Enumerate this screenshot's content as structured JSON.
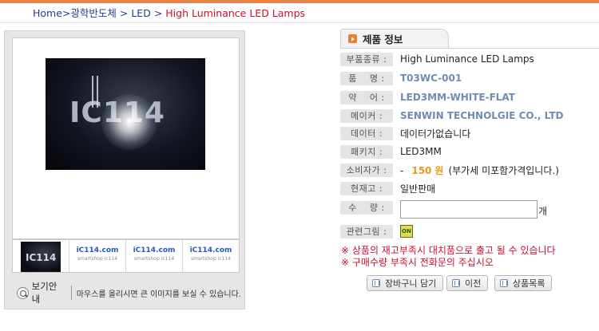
{
  "breadcrumb": {
    "home": "Home",
    "level1": "광학반도체",
    "level2": "LED",
    "current": "High Luminance LED Lamps",
    "sep": ">",
    "sep_spaced": " > "
  },
  "gallery": {
    "watermark": "IC114",
    "thumb_watermark": "IC114",
    "thumb_logo": "iC114.com",
    "thumb_logo_sub": "smartshop ic114",
    "guide_button_label": "보기안내",
    "guide_text": "마우스를 올리시면 큰 이미지를 보실 수 있습니다."
  },
  "product": {
    "tab_label": "제품 정보",
    "fields": {
      "category_label": "부품종류 :",
      "category_value": "High Luminance LED Lamps",
      "part_label": "품    명 :",
      "part_value": "T03WC-001",
      "abbr_label": "약    어 :",
      "abbr_value": "LED3MM-WHITE-FLAT",
      "maker_label": "메이커 :",
      "maker_value": "SENWIN TECHNOLGIE CO., LTD",
      "datasheet_label": "데이터 :",
      "datasheet_value": "데이터가없습니다",
      "package_label": "패키지 :",
      "package_value": "LED3MM",
      "price_label": "소비자가 :",
      "price_dash": "-",
      "price_value": "150",
      "price_currency": "원",
      "price_note": "(부가세 미포함가격입니다.)",
      "stock_label": "현재고 :",
      "stock_value": "일반판매",
      "qty_label": "수    량 :",
      "qty_value": "",
      "qty_unit": "개",
      "related_label": "관련그림 :"
    },
    "notices": [
      "※ 상품의 재고부족시 대치품으로 출고 될 수 있습니다",
      "※ 구매수량 부족시 전화문의 주십시오"
    ],
    "buttons": {
      "cart": "장바구니 담기",
      "prev": "이전",
      "list": "상품목록"
    }
  },
  "colors": {
    "accent_orange": "#ef7c2a",
    "breadcrumb_blue": "#1f3e8c",
    "breadcrumb_current": "#c8102e",
    "value_blue": "#6f8cb0",
    "price_orange": "#e79a1a",
    "notice_red": "#c8102e"
  }
}
